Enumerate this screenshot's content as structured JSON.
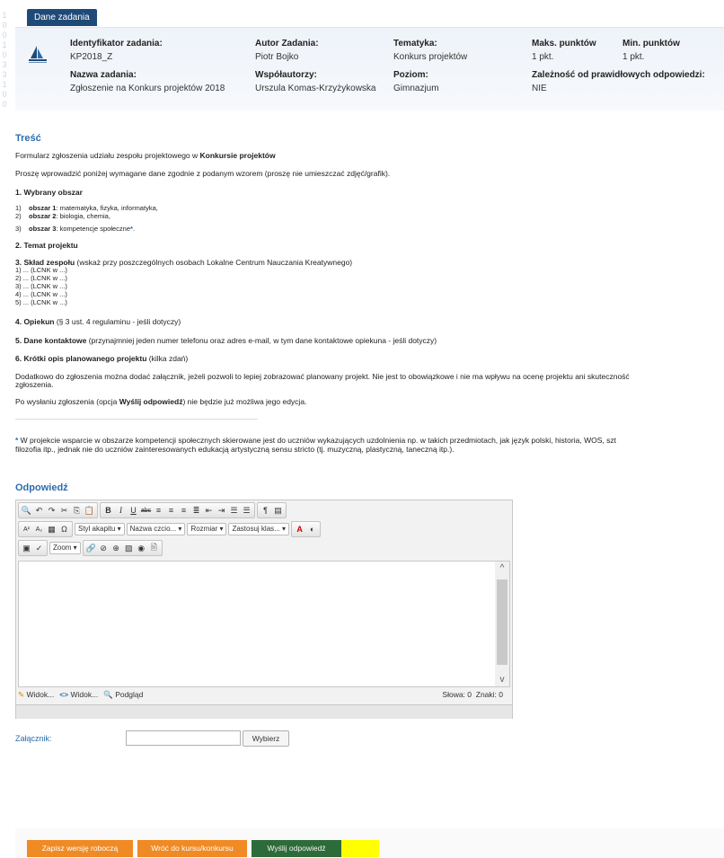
{
  "tab_label": "Dane zadania",
  "decor_digits": [
    "1",
    "0",
    "0",
    "1",
    "0",
    "3",
    "3",
    "1",
    "0",
    "0"
  ],
  "task": {
    "id_label": "Identyfikator zadania:",
    "id_value": "KP2018_Z",
    "author_label": "Autor Zadania:",
    "author_value": "Piotr Bojko",
    "topic_label": "Tematyka:",
    "topic_value": "Konkurs projektów",
    "max_label": "Maks. punktów",
    "max_value": "1 pkt.",
    "min_label": "Min. punktów",
    "min_value": "1 pkt.",
    "name_label": "Nazwa zadania:",
    "name_value": "Zgłoszenie na Konkurs projektów 2018",
    "coauthors_label": "Współautorzy:",
    "coauthors_value": "Urszula Komas-Krzyżykowska",
    "level_label": "Poziom:",
    "level_value": "Gimnazjum",
    "dependency_label": "Zależność od prawidłowych odpowiedzi:",
    "dependency_value": "NIE"
  },
  "content": {
    "heading": "Treść",
    "intro_pre": "Formularz zgłoszenia udziału zespołu projektowego w ",
    "intro_bold": "Konkursie projektów",
    "instruction": "Proszę wprowadzić poniżej wymagane dane zgodnie z podanym wzorem (proszę nie umieszczać zdjęć/grafik).",
    "s1_title": "1. Wybrany obszar",
    "areas": [
      {
        "num": "1)",
        "name": "obszar 1",
        "text": ": matematyka, fizyka, informatyka,"
      },
      {
        "num": "2)",
        "name": "obszar 2",
        "text": ": biologia, chemia,"
      },
      {
        "num": "3)",
        "name": "obszar 3",
        "text": ": kompetencje społeczne"
      }
    ],
    "area_star": "*",
    "area_end": ".",
    "s2_title": "2. Temat projektu",
    "s3_title": "3. Skład zespołu",
    "s3_note": " (wskaż przy poszczególnych osobach Lokalne Centrum Nauczania Kreatywnego)",
    "team_lines": [
      "1) ... (LCNK w ...)",
      "2) ... (LCNK w ...)",
      "3) ... (LCNK w ...)",
      "4) ... (LCNK w ...)",
      "5) ... (LCNK w ...)"
    ],
    "s4_title": "4. Opiekun",
    "s4_note": " (§ 3 ust. 4 regulaminu - jeśli dotyczy)",
    "s5_title": "5. Dane kontaktowe",
    "s5_note": " (przynajmniej jeden numer telefonu oraz adres e-mail, w tym dane kontaktowe opiekuna - jeśli dotyczy)",
    "s6_title": "6. Krótki opis planowanego projektu",
    "s6_note": " (kilka zdań)",
    "attach_line1": "Dodatkowo do zgłoszenia można dodać załącznik, jeżeli pozwoli to lepiej zobrazować planowany projekt. Nie jest to obowiązkowe i nie ma wpływu na ocenę projektu ani skuteczność",
    "attach_line2": "zgłoszenia.",
    "after_pre": "Po wysłaniu zgłoszenia (opcja ",
    "after_bold": "Wyślij odpowiedź",
    "after_post": ") nie będzie już możliwa jego edycja.",
    "foot_star": "*",
    "footnote1": " W projekcie wsparcie w obszarze kompetencji społecznych skierowane jest do uczniów wykazujących uzdolnienia np. w takich przedmiotach, jak język polski, historia, WOS, szt",
    "footnote2": "filozofia itp., jednak nie do uczniów zainteresowanych edukacją artystyczną sensu stricto (tj. muzyczną, plastyczną, taneczną itp.)."
  },
  "answer": {
    "heading": "Odpowiedź",
    "style_select": "Styl akapitu",
    "font_select": "Nazwa czcio...",
    "size_select": "Rozmiar",
    "apply_select": "Zastosuj klas...",
    "zoom_select": "Zoom",
    "mode_wysiwyg": "Widok...",
    "mode_code": "Widok...",
    "mode_preview": "Podgląd",
    "word_count": "Słowa: 0",
    "char_count": "Znaki: 0"
  },
  "attachment": {
    "label": "Załącznik:",
    "button": "Wybierz"
  },
  "actions": {
    "save_draft": "Zapisz wersję roboczą",
    "back": "Wróć do kursu/konkursu",
    "send": "Wyślij odpowiedź"
  },
  "colors": {
    "accent_blue": "#2b6dad",
    "tab_blue": "#1f4a78",
    "orange": "#f08a24",
    "green": "#2e6b3a",
    "highlight": "#ffff00"
  }
}
